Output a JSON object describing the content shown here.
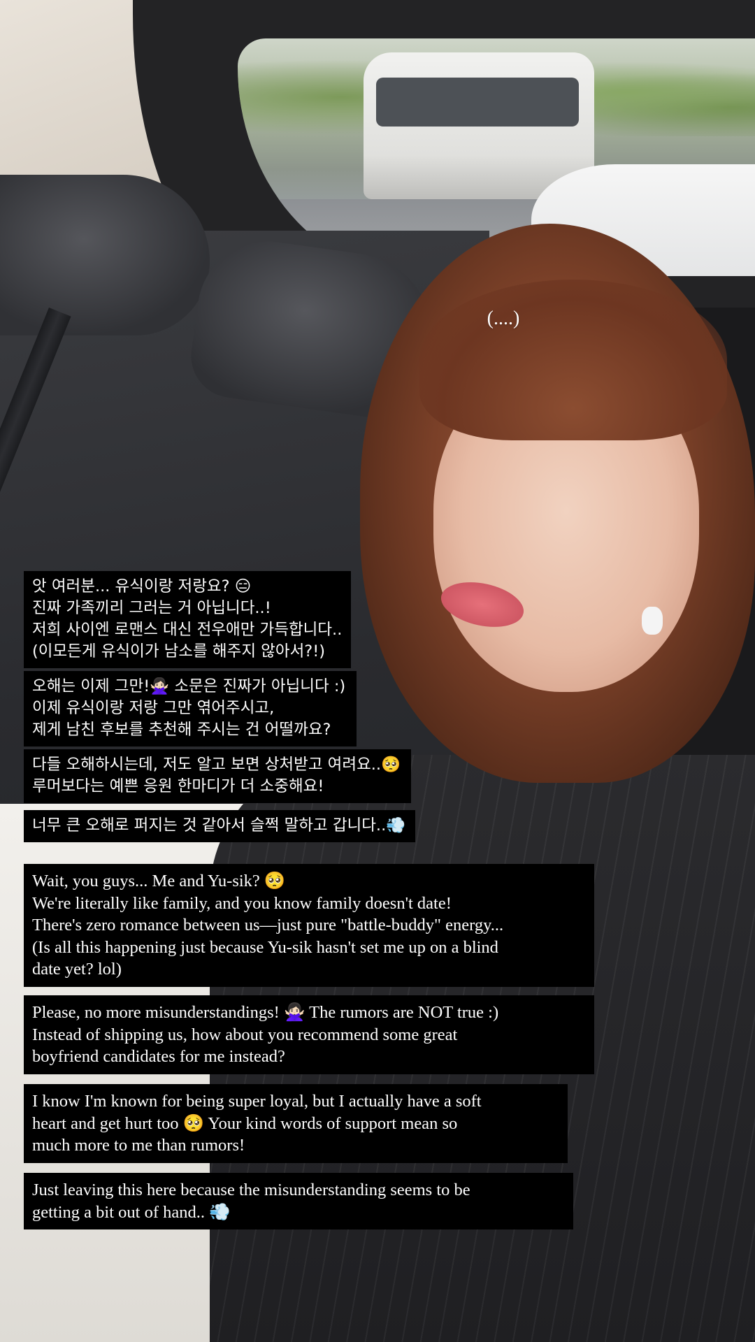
{
  "story": {
    "overlay_text": "(....)",
    "captions_korean": [
      "앗 여러분... 유식이랑 저랑요? 😑\n진짜 가족끼리 그러는 거 아닙니다..!\n저희 사이엔 로맨스 대신 전우애만 가득합니다..\n(이모든게 유식이가 남소를 해주지 않아서?!)",
      "오해는 이제 그만!🙅🏻‍♀️ 소문은 진짜가 아닙니다 :)\n이제 유식이랑 저랑 그만 엮어주시고,\n제게 남친 후보를 추천해 주시는 건 어떨까요?",
      "다들 오해하시는데, 저도 알고 보면 상처받고 여려요..🥺\n루머보다는 예쁜 응원 한마디가 더 소중해요!",
      "너무 큰 오해로 퍼지는 것 같아서 슬쩍 말하고 갑니다..💨"
    ],
    "captions_english": [
      "Wait, you guys... Me and Yu-sik? 🥺\nWe're literally like family, and you know family doesn't date!\nThere's zero romance between us—just pure \"battle-buddy\" energy...\n(Is all this happening just because Yu-sik hasn't set me up on a blind\ndate yet? lol)",
      "Please, no more misunderstandings! 🙅🏻‍♀️ The rumors are NOT true :)\nInstead of shipping us, how about you recommend some great\nboyfriend candidates for me instead?",
      "I know I'm known for being super loyal, but I actually have a soft\nheart and get hurt too 🥺 Your kind words of support mean so\nmuch more to me than rumors!",
      "Just leaving this here because the misunderstanding seems to be\ngetting a bit out of hand.. 💨"
    ],
    "colors": {
      "caption_background": "#000000",
      "caption_text": "#ffffff"
    }
  }
}
